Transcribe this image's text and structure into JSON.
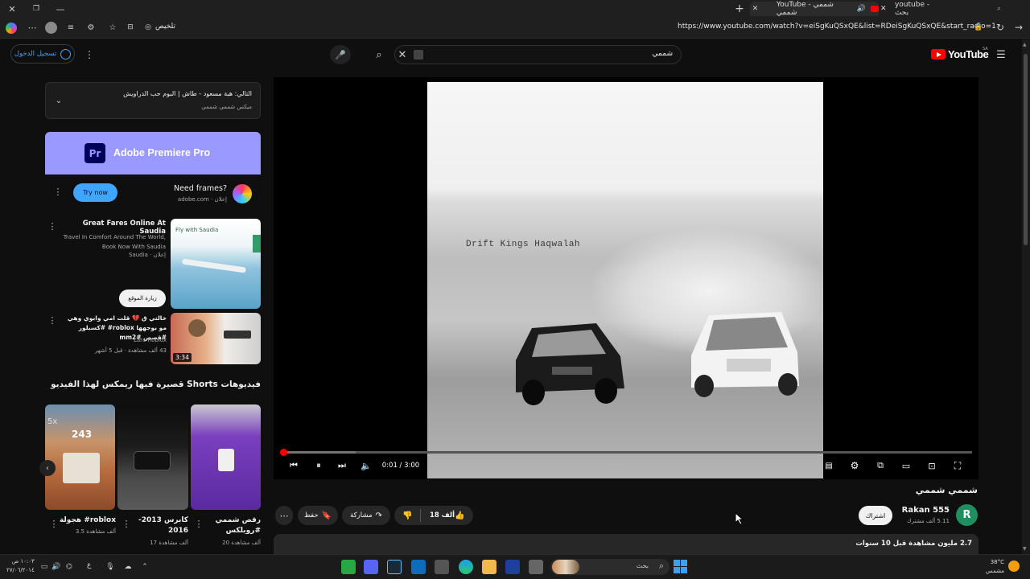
{
  "browser": {
    "tabs": [
      {
        "label": "YouTube - شممي شممي",
        "active": true
      },
      {
        "label": "youtube - بحث",
        "active": false
      }
    ],
    "url": "https://www.youtube.com/watch?v=eiSgKuQSxQE&list=RDeiSgKuQSxQE&start_radio=1",
    "summarize_label": "تلخيص"
  },
  "header": {
    "logo_text": "YouTube",
    "region": "SA",
    "search_value": "شممي",
    "sign_in_label": "تسجيل الدخول"
  },
  "playlist": {
    "title": "التالي: هبة مسعود - طاش | البوم حب الدراويش",
    "subtitle": "ميكس شممي شممي"
  },
  "ad_premiere": {
    "banner_text": "Adobe Premiere Pro",
    "logo_text": "Pr",
    "title": "Need frames?",
    "sponsor": "adobe.com · إعلان",
    "cta": "Try now"
  },
  "ad_saudia": {
    "title": "Great Fares Online At Saudia",
    "desc": "Travel In Comfort Around The World, Book Now With Saudia",
    "sponsor": "Saudia · إعلان",
    "cta": "زيارة الموقع",
    "thumb_text": "Fly with Saudia"
  },
  "rec_video": {
    "title": "خالتي ق 💔 قلت امي وابوي وهي مو بوجهها roblox# #كسبلور #قصص mm2#",
    "channel": "Lara Roblox",
    "meta": "43 ألف مشاهدة · قبل 5 أشهر",
    "duration": "3:34"
  },
  "shorts": {
    "heading": "فيديوهات Shorts قصيرة فيها ريمكس لهذا الفيديو",
    "items": [
      {
        "title": "هجولة #roblox",
        "views": "3.5 ألف مشاهدة"
      },
      {
        "title": "كابرس 2013-2016",
        "views": "17 ألف مشاهدة"
      },
      {
        "title": "رقص شممي #روبلكس",
        "views": "20 ألف مشاهدة"
      }
    ],
    "thumb1_overlay": "243",
    "thumb1_badge": "5x"
  },
  "video": {
    "overlay_text": "Drift Kings Haqwalah",
    "time": "0:01 / 3:00",
    "progress": 0.01,
    "title": "شممي شممي",
    "channel": "Rakan 555",
    "subs": "5.11 ألف مشترك",
    "avatar_letter": "R",
    "subscribe": "اشتراك",
    "likes": "18 ألف",
    "share": "مشاركة",
    "save": "حفظ",
    "desc_meta": "2.7 مليون مشاهدة  قبل 10 سنوات"
  },
  "taskbar": {
    "weather_temp": "38°C",
    "weather_desc": "مشمس",
    "search_label": "بحث",
    "time": "١٠:٠٣ ص",
    "date": "٢٧/٠٦/٢٠١٤",
    "lang": "ع"
  },
  "colors": {
    "yt_red": "#ff0000",
    "link_blue": "#3ea6ff",
    "premiere_purple": "#9999ff",
    "avatar_green": "#1f8f5f"
  }
}
